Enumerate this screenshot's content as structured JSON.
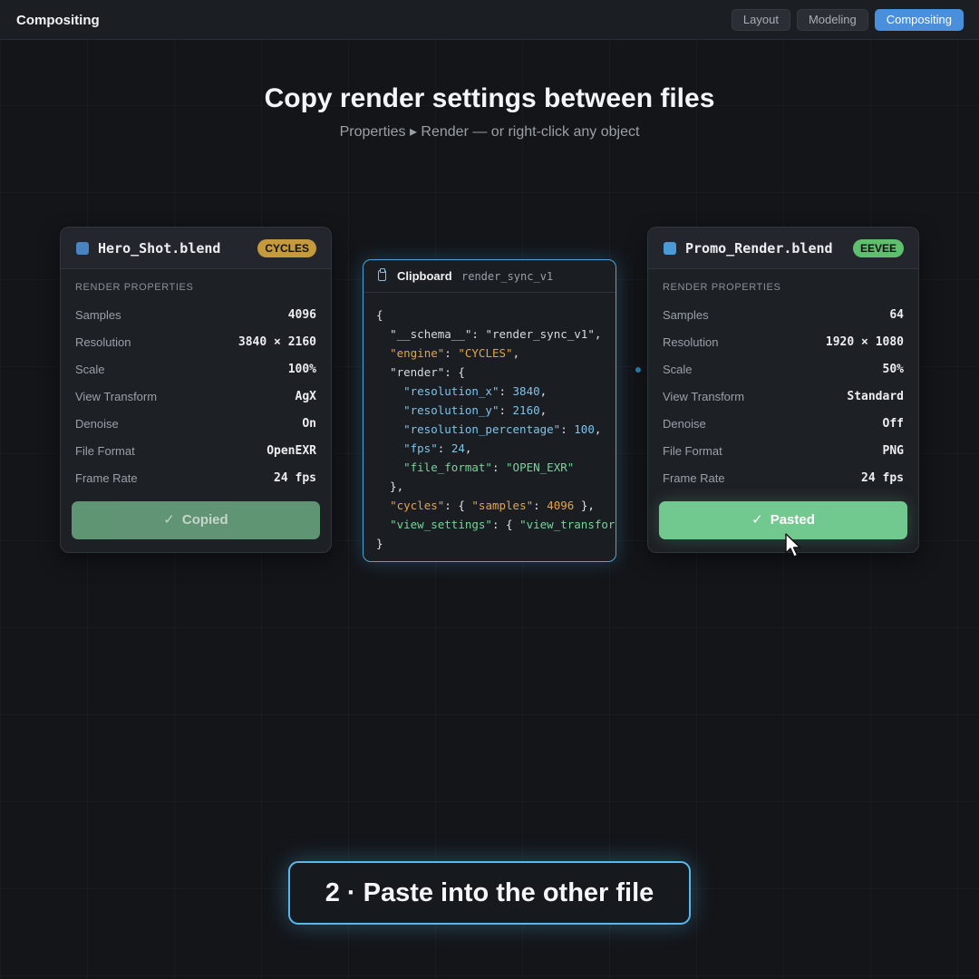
{
  "app": {
    "title": "Compositing"
  },
  "tabs": [
    {
      "label": "Layout",
      "active": false
    },
    {
      "label": "Modeling",
      "active": false
    },
    {
      "label": "Compositing",
      "active": true
    }
  ],
  "hero": {
    "title": "Copy render settings between files",
    "subtitle": "Properties ▸ Render — or right-click any object"
  },
  "source_file": {
    "name": "Hero_Shot.blend",
    "engine": "CYCLES",
    "engine_color": "#c49a3c",
    "square_color": "#4a83c2",
    "section_label": "RENDER PROPERTIES",
    "props": [
      {
        "key": "Samples",
        "value": "4096"
      },
      {
        "key": "Resolution",
        "value": "3840 × 2160"
      },
      {
        "key": "Scale",
        "value": "100%"
      },
      {
        "key": "View Transform",
        "value": "AgX"
      },
      {
        "key": "Denoise",
        "value": "On"
      },
      {
        "key": "File Format",
        "value": "OpenEXR"
      },
      {
        "key": "Frame Rate",
        "value": "24 fps"
      }
    ],
    "button_label": "Copied"
  },
  "clipboard": {
    "title": "Clipboard",
    "tag": "render_sync_v1",
    "icon": "clipboard-icon"
  },
  "target_file": {
    "name": "Promo_Render.blend",
    "engine": "EEVEE",
    "engine_color": "#5fbf6e",
    "square_color": "#4a9ad8",
    "section_label": "RENDER PROPERTIES",
    "props": [
      {
        "key": "Samples",
        "value": "64"
      },
      {
        "key": "Resolution",
        "value": "1920 × 1080"
      },
      {
        "key": "Scale",
        "value": "50%"
      },
      {
        "key": "View Transform",
        "value": "Standard"
      },
      {
        "key": "Denoise",
        "value": "Off"
      },
      {
        "key": "File Format",
        "value": "PNG"
      },
      {
        "key": "Frame Rate",
        "value": "24 fps"
      }
    ],
    "button_label": "Pasted"
  },
  "step": {
    "label": "2 · Paste into the other file"
  },
  "colors": {
    "accent": "#4a8fdb",
    "clipboard_border": "#4da3d8",
    "success": "#72c98f"
  }
}
